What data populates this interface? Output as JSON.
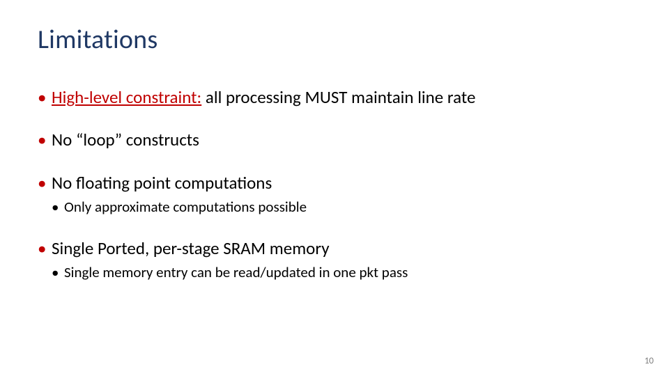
{
  "title": "Limitations",
  "bullets": {
    "b1": {
      "highlight": "High-level constraint:",
      "rest": " all processing MUST maintain line rate"
    },
    "b2": {
      "text": "No “loop” constructs"
    },
    "b3": {
      "text": "No floating point computations",
      "sub": "Only approximate computations possible"
    },
    "b4": {
      "text": "Single Ported, per-stage SRAM memory",
      "sub": "Single memory entry can be read/updated in one pkt pass"
    }
  },
  "page_number": "10"
}
